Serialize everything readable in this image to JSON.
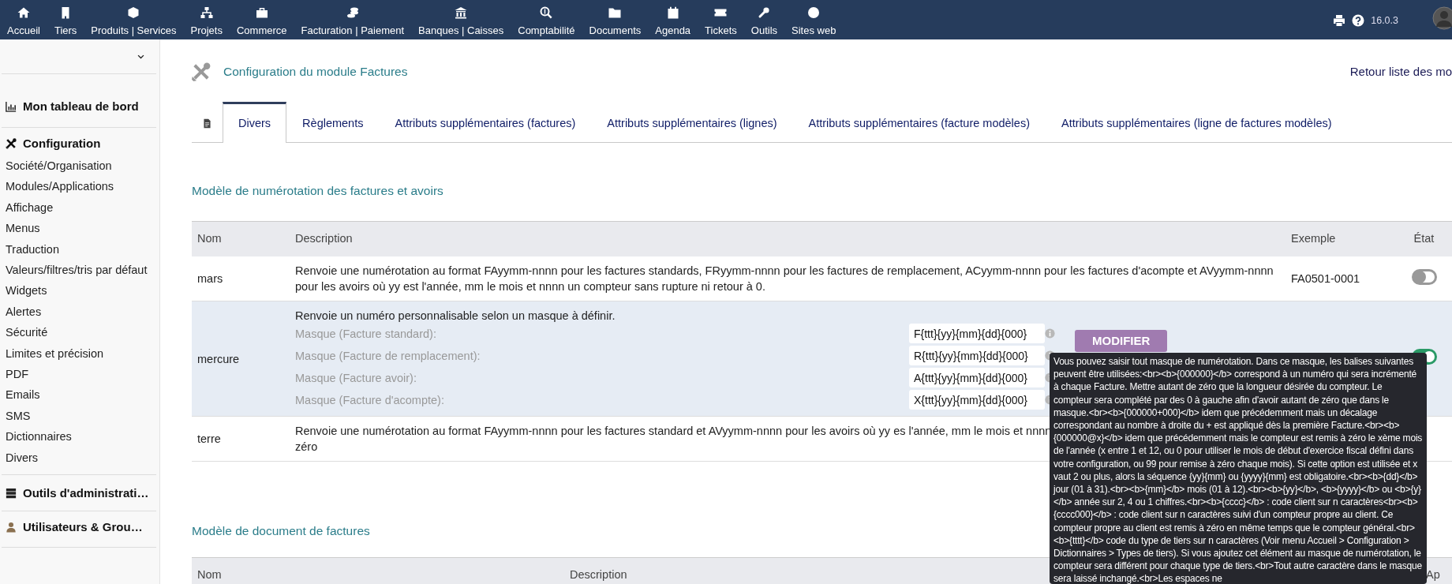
{
  "topnav": {
    "items": [
      {
        "label": "Accueil"
      },
      {
        "label": "Tiers"
      },
      {
        "label": "Produits | Services"
      },
      {
        "label": "Projets"
      },
      {
        "label": "Commerce"
      },
      {
        "label": "Facturation | Paiement"
      },
      {
        "label": "Banques | Caisses"
      },
      {
        "label": "Comptabilité"
      },
      {
        "label": "Documents"
      },
      {
        "label": "Agenda"
      },
      {
        "label": "Tickets"
      },
      {
        "label": "Outils"
      },
      {
        "label": "Sites web"
      }
    ],
    "version": "16.0.3"
  },
  "sidebar": {
    "sections": [
      {
        "title": "Mon tableau de bord"
      },
      {
        "title": "Configuration",
        "items": [
          "Société/Organisation",
          "Modules/Applications",
          "Affichage",
          "Menus",
          "Traduction",
          "Valeurs/filtres/tris par défaut",
          "Widgets",
          "Alertes",
          "Sécurité",
          "Limites et précision",
          "PDF",
          "Emails",
          "SMS",
          "Dictionnaires",
          "Divers"
        ]
      },
      {
        "title": "Outils d'administrati…"
      },
      {
        "title": "Utilisateurs & Grou…"
      }
    ]
  },
  "header": {
    "title": "Configuration du module Factures",
    "back_link": "Retour liste des mo"
  },
  "tabs": [
    {
      "kind": "icon",
      "selected": false
    },
    {
      "kind": "text",
      "label": "Divers",
      "selected": true
    },
    {
      "kind": "text",
      "label": "Règlements",
      "selected": false
    },
    {
      "kind": "text",
      "label": "Attributs supplémentaires (factures)",
      "selected": false
    },
    {
      "kind": "text",
      "label": "Attributs supplémentaires (lignes)",
      "selected": false
    },
    {
      "kind": "text",
      "label": "Attributs supplémentaires (facture modèles)",
      "selected": false
    },
    {
      "kind": "text",
      "label": "Attributs supplémentaires (ligne de factures modèles)",
      "selected": false
    }
  ],
  "numbering": {
    "title": "Modèle de numérotation des factures et avoirs",
    "columns": [
      "Nom",
      "Description",
      "Exemple",
      "État"
    ],
    "rows": [
      {
        "kind": "simple",
        "name": "mars",
        "highlighted": false,
        "description_lines": [
          "Renvoie une numérotation au format FAyymm-nnnn pour les factures standards, FRyymm-nnnn pour les factures de remplacement, ACyymm-nnnn pour les factures d'acompte et AVyymm-nnnn pour les avoirs où yy est l'année, mm le mois et nnnn un compteur sans rupture ni retour à 0."
        ],
        "example": "FA0501-0001",
        "enabled": false
      },
      {
        "kind": "mask",
        "name": "mercure",
        "highlighted": true,
        "description_lines": [
          "Renvoie un numéro personnalisable selon un masque à définir."
        ],
        "masks": [
          {
            "label": "Masque (Facture standard):",
            "value": "F{ttt}{yy}{mm}{dd}{000}"
          },
          {
            "label": "Masque (Facture de remplacement):",
            "value": "R{ttt}{yy}{mm}{dd}{000}"
          },
          {
            "label": "Masque (Facture avoir):",
            "value": "A{ttt}{yy}{mm}{dd}{000}"
          },
          {
            "label": "Masque (Facture d'acompte):",
            "value": "X{ttt}{yy}{mm}{dd}{000}"
          }
        ],
        "button": "MODIFIER",
        "enabled": true
      },
      {
        "kind": "simple",
        "name": "terre",
        "highlighted": false,
        "description_lines": [
          "Renvoie une numérotation au format FAyymm-nnnn pour les factures standard et AVyymm-nnnn pour les avoirs où yy es l'année, mm le mois et nnnn",
          "zéro"
        ]
      }
    ]
  },
  "templates": {
    "title": "Modèle de document de factures",
    "columns": [
      "Nom",
      "Description",
      "Ap"
    ]
  },
  "tooltip": {
    "text": "Vous pouvez saisir tout masque de numérotation. Dans ce masque, les balises suivantes peuvent être utilisées:<br><b>{000000}</b> correspond à un numéro qui sera incrémenté à chaque Facture. Mettre autant de zéro que la longueur désirée du compteur. Le compteur sera complété par des 0 à gauche afin d'avoir autant de zéro que dans le masque.<br><b>{000000+000}</b> idem que précédemment mais un décalage correspondant au nombre à droite du + est appliqué dès la première Facture.<br><b>{000000@x}</b> idem que précédemment mais le compteur est remis à zéro le xème mois de l'année (x entre 1 et 12, ou 0 pour utiliser le mois de début d'exercice fiscal défini dans votre configuration, ou 99 pour remise à zéro chaque mois). Si cette option est utilisée et x vaut 2 ou plus, alors la séquence {yy}{mm} ou {yyyy}{mm} est obligatoire.<br><b>{dd}</b> jour (01 à 31).<br><b>{mm}</b> mois (01 à 12).<br><b>{yy}</b>, <b>{yyyy}</b> ou <b>{y}</b> année sur 2, 4 ou 1 chiffres.<br><b>{cccc}</b> : code client sur n caractères<br><b>{cccc000}</b> : code client sur n caractères suivi d'un compteur propre au client. Ce compteur propre au client est remis à zéro en même temps que le compteur général.<br><b>{tttt}</b> code du type de tiers sur n caractères (Voir menu Accueil > Configuration > Dictionnaires > Types de tiers). Si vous ajoutez cet élément au masque de numérotation, le compteur sera différent pour chaque type de tiers.<br>Tout autre caractère dans le masque sera laissé inchangé.<br>Les espaces ne"
  }
}
